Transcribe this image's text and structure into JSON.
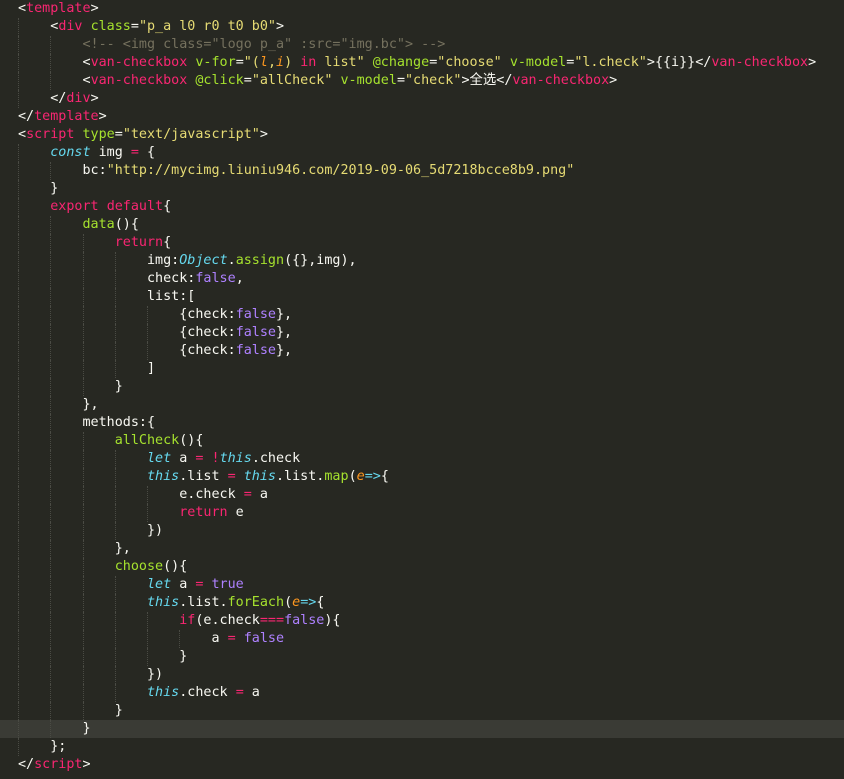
{
  "editor": {
    "current_line": 40,
    "indent_unit": "    ",
    "lines": [
      {
        "indent": 0,
        "tokens": [
          [
            "punct",
            "<"
          ],
          [
            "tag",
            "template"
          ],
          [
            "punct",
            ">"
          ]
        ]
      },
      {
        "indent": 1,
        "tokens": [
          [
            "punct",
            "<"
          ],
          [
            "tag",
            "div"
          ],
          [
            "plain",
            " "
          ],
          [
            "attr",
            "class"
          ],
          [
            "punct",
            "="
          ],
          [
            "string",
            "\"p_a l0 r0 t0 b0\""
          ],
          [
            "punct",
            ">"
          ]
        ]
      },
      {
        "indent": 2,
        "tokens": [
          [
            "comment",
            "<!-- <img class=\"logo p_a\" :src=\"img.bc\"> -->"
          ]
        ]
      },
      {
        "indent": 2,
        "tokens": [
          [
            "punct",
            "<"
          ],
          [
            "tag",
            "van-checkbox"
          ],
          [
            "plain",
            " "
          ],
          [
            "attr",
            "v-for"
          ],
          [
            "punct",
            "="
          ],
          [
            "string",
            "\"("
          ],
          [
            "param",
            "l"
          ],
          [
            "string",
            ","
          ],
          [
            "param",
            "i"
          ],
          [
            "string",
            ") "
          ],
          [
            "keyword",
            "in"
          ],
          [
            "string",
            " list\""
          ],
          [
            "plain",
            " "
          ],
          [
            "attr",
            "@change"
          ],
          [
            "punct",
            "="
          ],
          [
            "string",
            "\"choose\""
          ],
          [
            "plain",
            " "
          ],
          [
            "attr",
            "v-model"
          ],
          [
            "punct",
            "="
          ],
          [
            "string",
            "\"l.check\""
          ],
          [
            "punct",
            ">"
          ],
          [
            "plain",
            "{{i}}"
          ],
          [
            "punct",
            "</"
          ],
          [
            "tag",
            "van-checkbox"
          ],
          [
            "punct",
            ">"
          ]
        ]
      },
      {
        "indent": 2,
        "tokens": [
          [
            "punct",
            "<"
          ],
          [
            "tag",
            "van-checkbox"
          ],
          [
            "plain",
            " "
          ],
          [
            "attr",
            "@click"
          ],
          [
            "punct",
            "="
          ],
          [
            "string",
            "\"allCheck\""
          ],
          [
            "plain",
            " "
          ],
          [
            "attr",
            "v-model"
          ],
          [
            "punct",
            "="
          ],
          [
            "string",
            "\"check\""
          ],
          [
            "punct",
            ">"
          ],
          [
            "plain",
            "全选"
          ],
          [
            "punct",
            "</"
          ],
          [
            "tag",
            "van-checkbox"
          ],
          [
            "punct",
            ">"
          ]
        ]
      },
      {
        "indent": 1,
        "tokens": [
          [
            "punct",
            "</"
          ],
          [
            "tag",
            "div"
          ],
          [
            "punct",
            ">"
          ]
        ]
      },
      {
        "indent": 0,
        "tokens": [
          [
            "punct",
            "</"
          ],
          [
            "tag",
            "template"
          ],
          [
            "punct",
            ">"
          ]
        ]
      },
      {
        "indent": 0,
        "tokens": [
          [
            "punct",
            "<"
          ],
          [
            "tag",
            "script"
          ],
          [
            "plain",
            " "
          ],
          [
            "attr",
            "type"
          ],
          [
            "punct",
            "="
          ],
          [
            "string",
            "\"text/javascript\""
          ],
          [
            "punct",
            ">"
          ]
        ]
      },
      {
        "indent": 1,
        "tokens": [
          [
            "storage",
            "const"
          ],
          [
            "plain",
            " img "
          ],
          [
            "keyword",
            "="
          ],
          [
            "plain",
            " {"
          ]
        ]
      },
      {
        "indent": 2,
        "tokens": [
          [
            "plain",
            "bc:"
          ],
          [
            "string",
            "\"http://mycimg.liuniu946.com/2019-09-06_5d7218bcce8b9.png\""
          ]
        ]
      },
      {
        "indent": 1,
        "tokens": [
          [
            "plain",
            "}"
          ]
        ]
      },
      {
        "indent": 1,
        "tokens": [
          [
            "keyword",
            "export"
          ],
          [
            "plain",
            " "
          ],
          [
            "keyword",
            "default"
          ],
          [
            "plain",
            "{"
          ]
        ]
      },
      {
        "indent": 2,
        "tokens": [
          [
            "func",
            "data"
          ],
          [
            "plain",
            "(){"
          ]
        ]
      },
      {
        "indent": 3,
        "tokens": [
          [
            "keyword",
            "return"
          ],
          [
            "plain",
            "{"
          ]
        ]
      },
      {
        "indent": 4,
        "tokens": [
          [
            "plain",
            "img:"
          ],
          [
            "builtin",
            "Object"
          ],
          [
            "plain",
            "."
          ],
          [
            "func",
            "assign"
          ],
          [
            "plain",
            "({},img),"
          ]
        ]
      },
      {
        "indent": 4,
        "tokens": [
          [
            "plain",
            "check:"
          ],
          [
            "const",
            "false"
          ],
          [
            "plain",
            ","
          ]
        ]
      },
      {
        "indent": 4,
        "tokens": [
          [
            "plain",
            "list:["
          ]
        ]
      },
      {
        "indent": 5,
        "tokens": [
          [
            "plain",
            "{check:"
          ],
          [
            "const",
            "false"
          ],
          [
            "plain",
            "},"
          ]
        ]
      },
      {
        "indent": 5,
        "tokens": [
          [
            "plain",
            "{check:"
          ],
          [
            "const",
            "false"
          ],
          [
            "plain",
            "},"
          ]
        ]
      },
      {
        "indent": 5,
        "tokens": [
          [
            "plain",
            "{check:"
          ],
          [
            "const",
            "false"
          ],
          [
            "plain",
            "},"
          ]
        ]
      },
      {
        "indent": 4,
        "tokens": [
          [
            "plain",
            "]"
          ]
        ]
      },
      {
        "indent": 3,
        "tokens": [
          [
            "plain",
            "}"
          ]
        ]
      },
      {
        "indent": 2,
        "tokens": [
          [
            "plain",
            "},"
          ]
        ]
      },
      {
        "indent": 2,
        "tokens": [
          [
            "plain",
            "methods:{"
          ]
        ]
      },
      {
        "indent": 3,
        "tokens": [
          [
            "func",
            "allCheck"
          ],
          [
            "plain",
            "(){"
          ]
        ]
      },
      {
        "indent": 4,
        "tokens": [
          [
            "storage",
            "let"
          ],
          [
            "plain",
            " a "
          ],
          [
            "keyword",
            "="
          ],
          [
            "plain",
            " "
          ],
          [
            "keyword",
            "!"
          ],
          [
            "builtin",
            "this"
          ],
          [
            "plain",
            ".check"
          ]
        ]
      },
      {
        "indent": 4,
        "tokens": [
          [
            "builtin",
            "this"
          ],
          [
            "plain",
            ".list "
          ],
          [
            "keyword",
            "="
          ],
          [
            "plain",
            " "
          ],
          [
            "builtin",
            "this"
          ],
          [
            "plain",
            ".list."
          ],
          [
            "func",
            "map"
          ],
          [
            "plain",
            "("
          ],
          [
            "param",
            "e"
          ],
          [
            "storage",
            "=>"
          ],
          [
            "plain",
            "{"
          ]
        ]
      },
      {
        "indent": 5,
        "tokens": [
          [
            "plain",
            "e.check "
          ],
          [
            "keyword",
            "="
          ],
          [
            "plain",
            " a"
          ]
        ]
      },
      {
        "indent": 5,
        "tokens": [
          [
            "keyword",
            "return"
          ],
          [
            "plain",
            " e"
          ]
        ]
      },
      {
        "indent": 4,
        "tokens": [
          [
            "plain",
            "})"
          ]
        ]
      },
      {
        "indent": 3,
        "tokens": [
          [
            "plain",
            "},"
          ]
        ]
      },
      {
        "indent": 3,
        "tokens": [
          [
            "func",
            "choose"
          ],
          [
            "plain",
            "(){"
          ]
        ]
      },
      {
        "indent": 4,
        "tokens": [
          [
            "storage",
            "let"
          ],
          [
            "plain",
            " a "
          ],
          [
            "keyword",
            "="
          ],
          [
            "plain",
            " "
          ],
          [
            "const",
            "true"
          ]
        ]
      },
      {
        "indent": 4,
        "tokens": [
          [
            "builtin",
            "this"
          ],
          [
            "plain",
            ".list."
          ],
          [
            "func",
            "forEach"
          ],
          [
            "plain",
            "("
          ],
          [
            "param",
            "e"
          ],
          [
            "storage",
            "=>"
          ],
          [
            "plain",
            "{"
          ]
        ]
      },
      {
        "indent": 5,
        "tokens": [
          [
            "keyword",
            "if"
          ],
          [
            "plain",
            "(e.check"
          ],
          [
            "keyword",
            "==="
          ],
          [
            "const",
            "false"
          ],
          [
            "plain",
            "){"
          ]
        ]
      },
      {
        "indent": 6,
        "tokens": [
          [
            "plain",
            "a "
          ],
          [
            "keyword",
            "="
          ],
          [
            "plain",
            " "
          ],
          [
            "const",
            "false"
          ]
        ]
      },
      {
        "indent": 5,
        "tokens": [
          [
            "plain",
            "}"
          ]
        ]
      },
      {
        "indent": 4,
        "tokens": [
          [
            "plain",
            "})"
          ]
        ]
      },
      {
        "indent": 4,
        "tokens": [
          [
            "builtin",
            "this"
          ],
          [
            "plain",
            ".check "
          ],
          [
            "keyword",
            "="
          ],
          [
            "plain",
            " a"
          ]
        ]
      },
      {
        "indent": 3,
        "tokens": [
          [
            "plain",
            "}"
          ]
        ]
      },
      {
        "indent": 2,
        "tokens": [
          [
            "plain",
            "}"
          ]
        ]
      },
      {
        "indent": 1,
        "tokens": [
          [
            "plain",
            "};"
          ]
        ]
      },
      {
        "indent": 0,
        "tokens": [
          [
            "punct",
            "</"
          ],
          [
            "tag",
            "script"
          ],
          [
            "punct",
            ">"
          ]
        ]
      }
    ]
  }
}
